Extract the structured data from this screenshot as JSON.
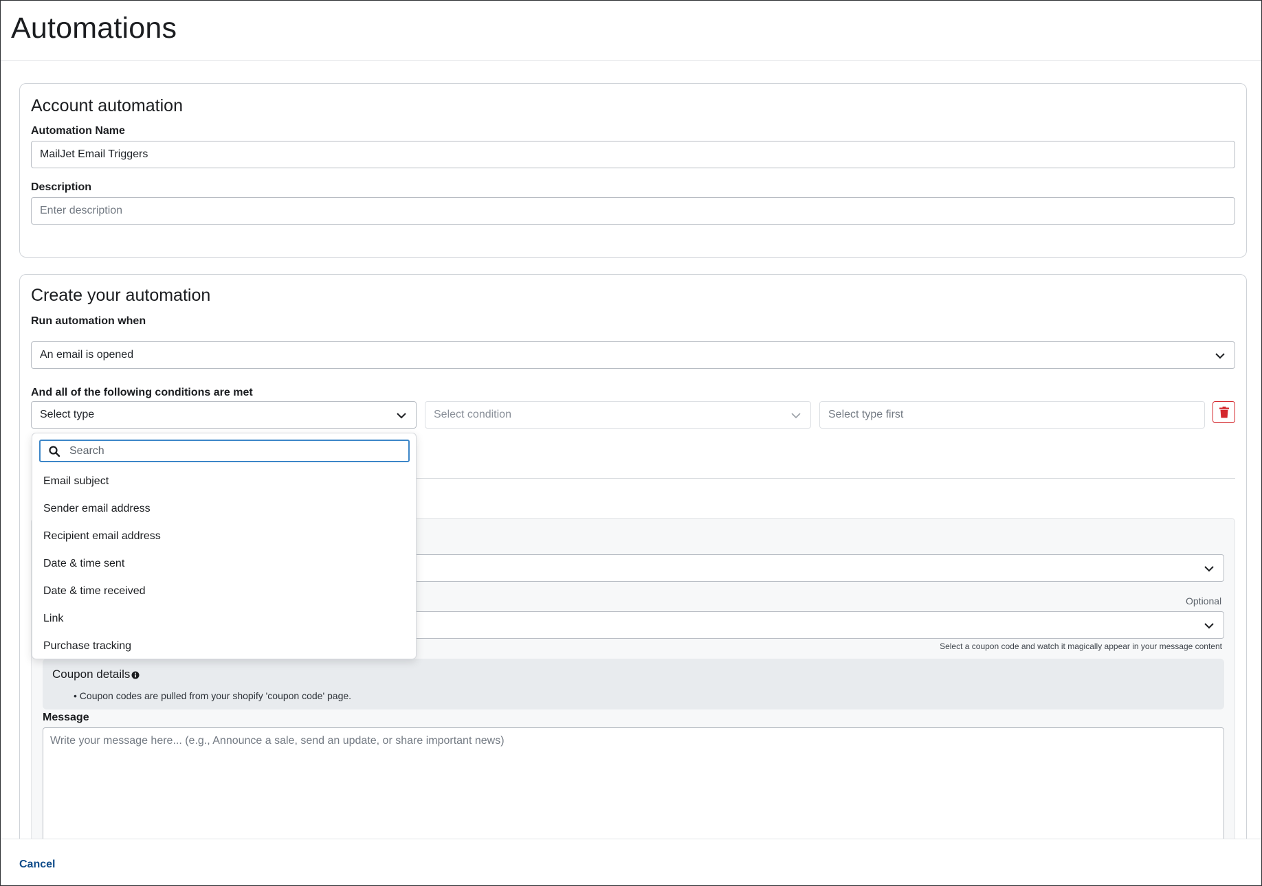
{
  "page": {
    "title": "Automations"
  },
  "account": {
    "title": "Account automation",
    "name_label": "Automation Name",
    "name_value": "MailJet Email Triggers",
    "description_label": "Description",
    "description_placeholder": "Enter description"
  },
  "create": {
    "title": "Create your automation",
    "trigger_label": "Run automation when",
    "trigger_value": "An email is opened",
    "conditions_label": "And all of the following conditions are met",
    "type_select": "Select type",
    "condition_select": "Select condition",
    "value_placeholder": "Select type first"
  },
  "dropdown": {
    "search_placeholder": "Search",
    "options": [
      "Email subject",
      "Sender email address",
      "Recipient email address",
      "Date & time sent",
      "Date & time received",
      "Link",
      "Purchase tracking"
    ]
  },
  "action": {
    "optional_label": "Optional",
    "coupon_hint": "Select a coupon code and watch it magically appear in your message content",
    "coupon_title": "Coupon details",
    "coupon_bullet": "• Coupon codes are pulled from your shopify 'coupon code' page.",
    "message_label": "Message",
    "message_placeholder": "Write your message here... (e.g., Announce a sale, send an update, or share important news)"
  },
  "footer": {
    "cancel": "Cancel"
  },
  "colors": {
    "accent": "#3c86c8",
    "danger": "#d4272d",
    "link": "#0f4c8a"
  }
}
